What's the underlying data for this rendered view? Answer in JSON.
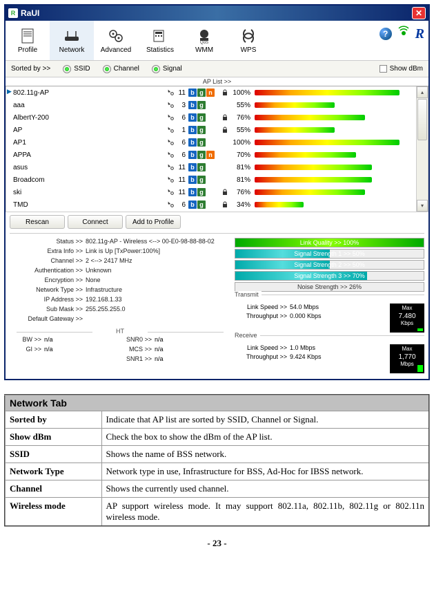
{
  "window": {
    "title": "RaUI"
  },
  "toolbar": {
    "tabs": [
      {
        "label": "Profile"
      },
      {
        "label": "Network"
      },
      {
        "label": "Advanced"
      },
      {
        "label": "Statistics"
      },
      {
        "label": "WMM"
      },
      {
        "label": "WPS"
      }
    ]
  },
  "sortbar": {
    "label": "Sorted by >>",
    "opt_ssid": "SSID",
    "opt_channel": "Channel",
    "opt_signal": "Signal",
    "show_dbm": "Show dBm"
  },
  "aplist": {
    "header": "AP List >>",
    "rows": [
      {
        "ssid": "802.11g-AP",
        "ch": "11",
        "b": true,
        "g": true,
        "n": true,
        "lock": true,
        "pct": "100%",
        "pctv": 100,
        "sel": true
      },
      {
        "ssid": "aaa",
        "ch": "3",
        "b": true,
        "g": true,
        "n": false,
        "lock": false,
        "pct": "55%",
        "pctv": 55
      },
      {
        "ssid": "AlbertY-200",
        "ch": "6",
        "b": true,
        "g": true,
        "n": false,
        "lock": true,
        "pct": "76%",
        "pctv": 76
      },
      {
        "ssid": "AP",
        "ch": "1",
        "b": true,
        "g": true,
        "n": false,
        "lock": true,
        "pct": "55%",
        "pctv": 55
      },
      {
        "ssid": "AP1",
        "ch": "6",
        "b": true,
        "g": true,
        "n": false,
        "lock": false,
        "pct": "100%",
        "pctv": 100
      },
      {
        "ssid": "APPA",
        "ch": "6",
        "b": true,
        "g": true,
        "n": true,
        "lock": false,
        "pct": "70%",
        "pctv": 70
      },
      {
        "ssid": "asus",
        "ch": "11",
        "b": true,
        "g": true,
        "n": false,
        "lock": false,
        "pct": "81%",
        "pctv": 81
      },
      {
        "ssid": "Broadcom",
        "ch": "11",
        "b": true,
        "g": true,
        "n": false,
        "lock": false,
        "pct": "81%",
        "pctv": 81
      },
      {
        "ssid": "ski",
        "ch": "11",
        "b": true,
        "g": true,
        "n": false,
        "lock": true,
        "pct": "76%",
        "pctv": 76
      },
      {
        "ssid": "TMD",
        "ch": "6",
        "b": true,
        "g": true,
        "n": false,
        "lock": true,
        "pct": "34%",
        "pctv": 34
      }
    ]
  },
  "buttons": {
    "rescan": "Rescan",
    "connect": "Connect",
    "addprofile": "Add to Profile"
  },
  "info": {
    "status_k": "Status >>",
    "status_v": "802.11g-AP - Wireless  <--> 00-E0-98-88-88-02",
    "extra_k": "Extra Info >>",
    "extra_v": "Link is Up [TxPower:100%]",
    "channel_k": "Channel >>",
    "channel_v": "2 <--> 2417 MHz",
    "auth_k": "Authentication >>",
    "auth_v": "Unknown",
    "enc_k": "Encryption >>",
    "enc_v": "None",
    "ntype_k": "Network Type >>",
    "ntype_v": "Infrastructure",
    "ip_k": "IP Address >>",
    "ip_v": "192.168.1.33",
    "mask_k": "Sub Mask >>",
    "mask_v": "255.255.255.0",
    "gw_k": "Default Gateway >>",
    "gw_v": "",
    "ht_label": "HT",
    "bw_k": "BW >>",
    "bw_v": "n/a",
    "gi_k": "GI >>",
    "gi_v": "n/a",
    "mcs_k": "MCS >>",
    "mcs_v": "n/a",
    "snr0_k": "SNR0 >>",
    "snr0_v": "n/a",
    "snr1_k": "SNR1 >>",
    "snr1_v": "n/a"
  },
  "quality": {
    "link": "Link Quality >> 100%",
    "link_pct": 100,
    "s1": "Signal Strength 1 >> 50%",
    "s1_pct": 50,
    "s2": "Signal Strength 2 >> 50%",
    "s2_pct": 50,
    "s3": "Signal Strength 3 >> 70%",
    "s3_pct": 70,
    "noise": "Noise Strength >> 26%",
    "noise_pct": 26
  },
  "transmit": {
    "label": "Transmit",
    "ls_k": "Link Speed >>",
    "ls_v": "54.0 Mbps",
    "tp_k": "Throughput >>",
    "tp_v": "0.000 Kbps",
    "gmax": "Max",
    "gval": "7.480",
    "gunit": "Kbps"
  },
  "receive": {
    "label": "Receive",
    "ls_k": "Link Speed >>",
    "ls_v": "1.0 Mbps",
    "tp_k": "Throughput >>",
    "tp_v": "9.424 Kbps",
    "gmax": "Max",
    "gval": "1,770",
    "gunit": "Mbps"
  },
  "caption": {
    "title": "Network Tab",
    "rows": [
      {
        "k": "Sorted by",
        "v": "Indicate that AP list are sorted by SSID, Channel or Signal."
      },
      {
        "k": "Show dBm",
        "v": "Check the box to show the dBm of the AP list."
      },
      {
        "k": "SSID",
        "v": "Shows the name of BSS network."
      },
      {
        "k": "Network Type",
        "v": "Network type in use, Infrastructure for BSS, Ad-Hoc for IBSS network.",
        "justify": true
      },
      {
        "k": "Channel",
        "v": "Shows the currently used channel."
      },
      {
        "k": "Wireless mode",
        "v": "AP support wireless mode. It may support 802.11a, 802.11b, 802.11g or 802.11n wireless mode.",
        "justify": true
      }
    ]
  },
  "pagenum": "- 23 -"
}
